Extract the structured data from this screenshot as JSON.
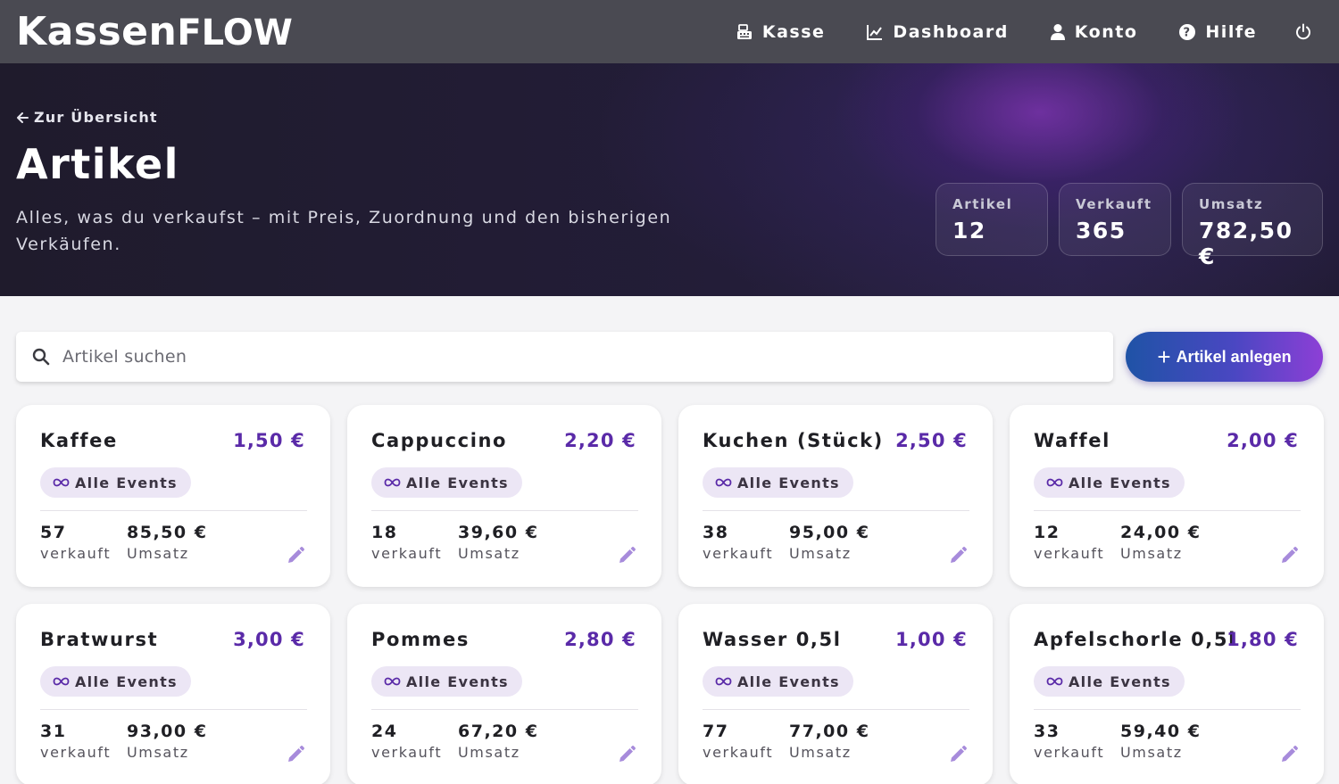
{
  "app": {
    "logo": "KassenFlow",
    "logo_part1": "Kassen",
    "logo_part2": "FLOW"
  },
  "nav": {
    "items": [
      {
        "label": "Kasse",
        "icon": "cash-register-icon"
      },
      {
        "label": "Dashboard",
        "icon": "chart-line-icon"
      },
      {
        "label": "Konto",
        "icon": "user-icon"
      },
      {
        "label": "Hilfe",
        "icon": "help-circle-icon"
      }
    ],
    "power_icon": "power-icon"
  },
  "hero": {
    "back_label": "Zur Übersicht",
    "title": "Artikel",
    "subtitle": "Alles, was du verkaufst – mit Preis, Zuordnung und den bisherigen Verkäufen.",
    "stats": [
      {
        "label": "Artikel",
        "value": "12"
      },
      {
        "label": "Verkauft",
        "value": "365"
      },
      {
        "label": "Umsatz",
        "value": "782,50 €"
      }
    ]
  },
  "search": {
    "placeholder": "Artikel suchen",
    "value": ""
  },
  "add_button": {
    "label": "Artikel anlegen"
  },
  "colors": {
    "accent": "#5a2aa8",
    "button_start": "#1f53a6",
    "button_end": "#8d3fd6",
    "nav_bg": "#4a4a52"
  },
  "cards": [
    {
      "name": "Kaffee",
      "price": "1,50 €",
      "badge": "Alle Events",
      "sold": "57",
      "sold_label": "verkauft",
      "revenue": "85,50 €",
      "revenue_label": "Umsatz"
    },
    {
      "name": "Cappuccino",
      "price": "2,20 €",
      "badge": "Alle Events",
      "sold": "18",
      "sold_label": "verkauft",
      "revenue": "39,60 €",
      "revenue_label": "Umsatz"
    },
    {
      "name": "Kuchen (Stück)",
      "price": "2,50 €",
      "badge": "Alle Events",
      "sold": "38",
      "sold_label": "verkauft",
      "revenue": "95,00 €",
      "revenue_label": "Umsatz"
    },
    {
      "name": "Waffel",
      "price": "2,00 €",
      "badge": "Alle Events",
      "sold": "12",
      "sold_label": "verkauft",
      "revenue": "24,00 €",
      "revenue_label": "Umsatz"
    },
    {
      "name": "Bratwurst",
      "price": "3,00 €",
      "badge": "Alle Events",
      "sold": "31",
      "sold_label": "verkauft",
      "revenue": "93,00 €",
      "revenue_label": "Umsatz"
    },
    {
      "name": "Pommes",
      "price": "2,80 €",
      "badge": "Alle Events",
      "sold": "24",
      "sold_label": "verkauft",
      "revenue": "67,20 €",
      "revenue_label": "Umsatz"
    },
    {
      "name": "Wasser 0,5l",
      "price": "1,00 €",
      "badge": "Alle Events",
      "sold": "77",
      "sold_label": "verkauft",
      "revenue": "77,00 €",
      "revenue_label": "Umsatz"
    },
    {
      "name": "Apfelschorle 0,5l",
      "price": "1,80 €",
      "badge": "Alle Events",
      "sold": "33",
      "sold_label": "verkauft",
      "revenue": "59,40 €",
      "revenue_label": "Umsatz"
    }
  ]
}
